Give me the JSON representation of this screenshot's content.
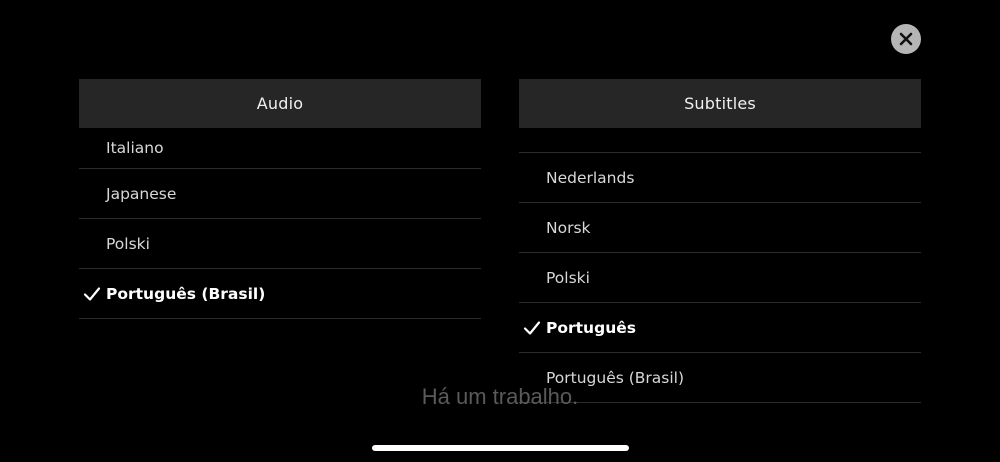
{
  "close": {
    "label": "Close"
  },
  "audio": {
    "title": "Audio",
    "items": [
      {
        "label": "Italiano",
        "selected": false
      },
      {
        "label": "Japanese",
        "selected": false
      },
      {
        "label": "Polski",
        "selected": false
      },
      {
        "label": "Português (Brasil)",
        "selected": true
      }
    ]
  },
  "subtitles": {
    "title": "Subtitles",
    "items": [
      {
        "label": "",
        "selected": false
      },
      {
        "label": "Nederlands",
        "selected": false
      },
      {
        "label": "Norsk",
        "selected": false
      },
      {
        "label": "Polski",
        "selected": false
      },
      {
        "label": "Português",
        "selected": true
      },
      {
        "label": "Português (Brasil)",
        "selected": false
      }
    ]
  },
  "caption": {
    "text": "Há um trabalho."
  },
  "icons": {
    "close": "close-icon",
    "check": "checkmark-icon"
  },
  "colors": {
    "background": "#000000",
    "header": "#262626",
    "divider": "#2c2c2c",
    "close_button": "#b5b5b5"
  }
}
